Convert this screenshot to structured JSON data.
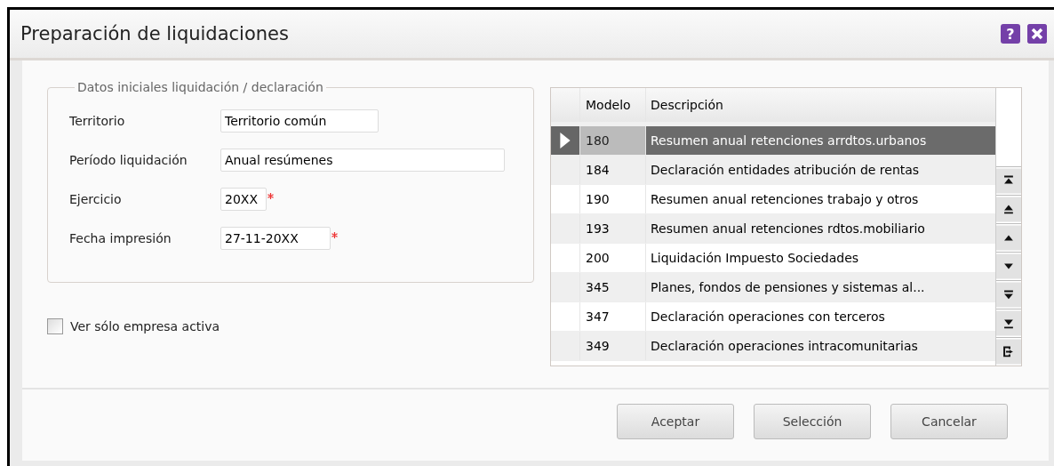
{
  "window": {
    "title": "Preparación de liquidaciones",
    "help_button": "?"
  },
  "group": {
    "legend": "Datos iniciales liquidación / declaración",
    "fields": [
      {
        "label": "Territorio",
        "value": "Territorio común",
        "required": false
      },
      {
        "label": "Período liquidación",
        "value": "Anual resúmenes",
        "required": false
      },
      {
        "label": "Ejercicio",
        "value": "20XX",
        "required": true
      },
      {
        "label": "Fecha impresión",
        "value": "27-11-20XX",
        "required": true
      }
    ]
  },
  "checkbox": {
    "label": "Ver sólo empresa activa",
    "checked": false
  },
  "table": {
    "columns": [
      "Modelo",
      "Descripción"
    ],
    "rows": [
      {
        "modelo": "180",
        "descripcion": "Resumen anual retenciones arrdtos.urbanos",
        "selected": true
      },
      {
        "modelo": "184",
        "descripcion": "Declaración entidades atribución de rentas",
        "selected": false
      },
      {
        "modelo": "190",
        "descripcion": "Resumen anual retenciones trabajo y otros",
        "selected": false
      },
      {
        "modelo": "193",
        "descripcion": "Resumen anual retenciones rdtos.mobiliario",
        "selected": false
      },
      {
        "modelo": "200",
        "descripcion": "Liquidación Impuesto Sociedades",
        "selected": false
      },
      {
        "modelo": "345",
        "descripcion": "Planes, fondos de pensiones y sistemas al...",
        "selected": false
      },
      {
        "modelo": "347",
        "descripcion": "Declaración operaciones con terceros",
        "selected": false
      },
      {
        "modelo": "349",
        "descripcion": "Declaración operaciones intracomunitarias",
        "selected": false
      }
    ]
  },
  "buttons": [
    "Aceptar",
    "Selección",
    "Cancelar"
  ]
}
